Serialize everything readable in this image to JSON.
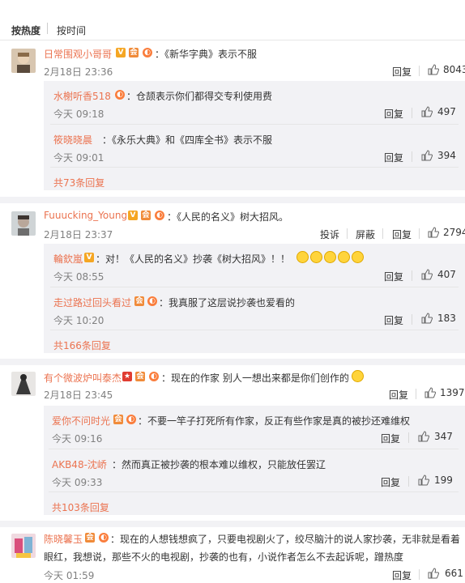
{
  "sort": {
    "hot": "按热度",
    "time": "按时间"
  },
  "actions": {
    "reply": "回复",
    "report": "投诉",
    "block": "屏蔽"
  },
  "threads": [
    {
      "user": "日常围观小哥哥",
      "text": "：《新华字典》表示不服",
      "time": "2月18日 23:36",
      "likes": "8043",
      "replies": [
        {
          "user": "水榭听香518",
          "text": "：仓颉表示你们都得交专利使用费",
          "time": "今天 09:18",
          "likes": "497"
        },
        {
          "user": "筱晓晓晨",
          "text": "：《永乐大典》和《四库全书》表示不服",
          "time": "今天 09:01",
          "likes": "394"
        }
      ],
      "more": "共73条回复"
    },
    {
      "user": "Fuuucking_Young",
      "text": "：《人民的名义》树大招风。",
      "time": "2月18日 23:37",
      "likes": "2794",
      "replies": [
        {
          "user": "輪欽嵐",
          "text": "：对！《人民的名义》抄袭《树大招风》！！",
          "time": "今天 08:55",
          "likes": "407"
        },
        {
          "user": "走过路过回头看过",
          "text": "：我真服了这层说抄袭也爱看的",
          "time": "今天 10:20",
          "likes": "183"
        }
      ],
      "more": "共166条回复"
    },
    {
      "user": "有个微波炉叫泰杰",
      "text": "：现在的作家 别人一想出来都是你们创作的",
      "time": "2月18日 23:45",
      "likes": "1397",
      "replies": [
        {
          "user": "爱你不问时光",
          "text": "：不要一竿子打死所有作家，反正有些作家是真的被抄还难维权",
          "time": "今天 09:16",
          "likes": "347"
        },
        {
          "user": "AKB48-沈峤",
          "text": "：然而真正被抄袭的根本难以维权，只能放任罢辽",
          "time": "今天 09:33",
          "likes": "199"
        }
      ],
      "more": "共103条回复"
    },
    {
      "user": "陈晓馨玉",
      "text": "：现在的人想钱想疯了，只要电视剧火了，绞尽脑汁的说人家抄袭，无非就是看着",
      "text2": "眼红，我想说，那些不火的电视剧，抄袭的也有，小说作者怎么不去起诉呢，蹭热度",
      "time": "今天 01:59",
      "likes": "661"
    }
  ],
  "colors": {
    "link": "#eb7350",
    "gap": "#f2f2f5",
    "sub_bg": "#f2f2f5"
  },
  "icons": [
    "thumb-up-icon",
    "vip-badge-icon",
    "member-badge-icon",
    "emoji-icon",
    "avatar"
  ]
}
